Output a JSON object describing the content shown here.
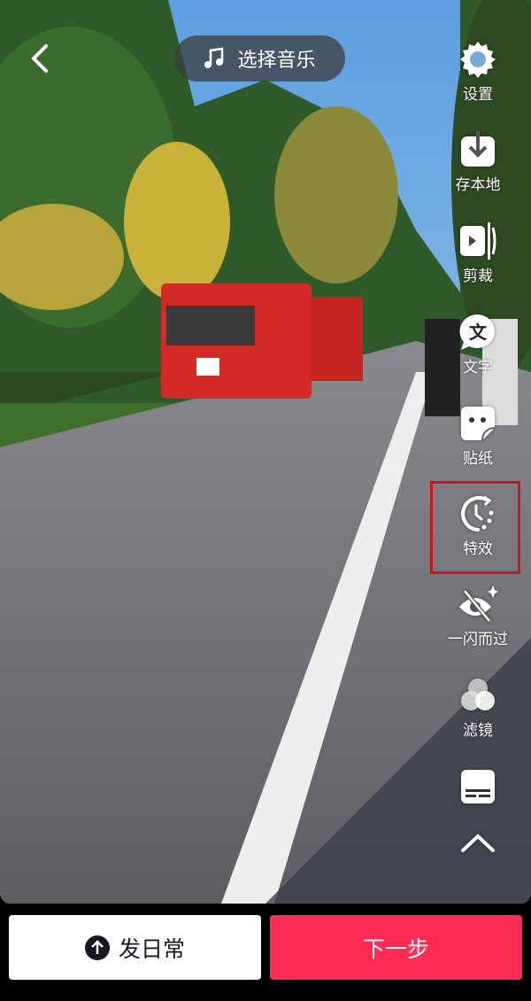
{
  "header": {
    "back_icon": "chevron-left-icon",
    "music_label": "选择音乐",
    "music_icon": "music-note-icon"
  },
  "toolbar": {
    "items": [
      {
        "label": "设置",
        "icon": "gear-icon"
      },
      {
        "label": "存本地",
        "icon": "download-icon"
      },
      {
        "label": "剪裁",
        "icon": "trim-icon"
      },
      {
        "label": "文字",
        "icon": "text-bubble-icon"
      },
      {
        "label": "贴纸",
        "icon": "sticker-icon"
      },
      {
        "label": "特效",
        "icon": "effects-timer-icon",
        "highlighted": true
      },
      {
        "label": "一闪而过",
        "icon": "eye-off-sparkle-icon"
      },
      {
        "label": "滤镜",
        "icon": "filter-circles-icon"
      }
    ],
    "caption_icon": "caption-icon",
    "expand_icon": "chevron-up-icon"
  },
  "footer": {
    "daily_label": "发日常",
    "daily_icon": "arrow-up-circle-icon",
    "next_label": "下一步"
  },
  "colors": {
    "accent": "#fe2c55",
    "highlight_box": "#c8171d"
  }
}
